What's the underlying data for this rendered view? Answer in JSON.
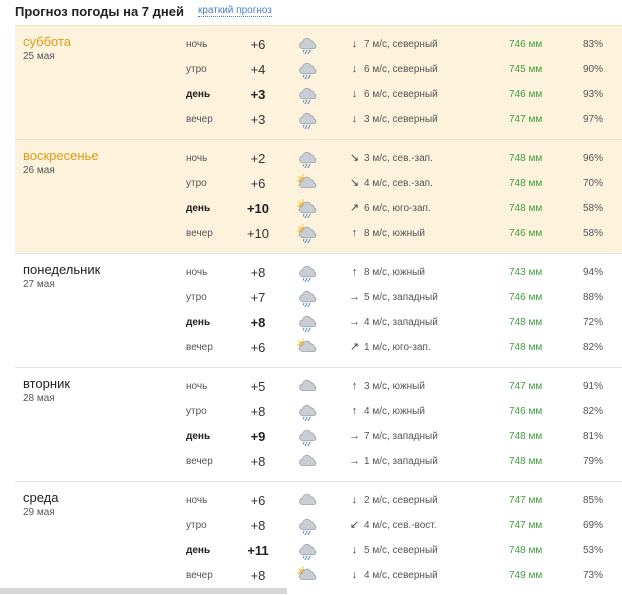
{
  "header": {
    "title": "Прогноз погоды на 7 дней",
    "brief_link": "краткий прогноз"
  },
  "days": [
    {
      "name": "суббота",
      "date": "25 мая",
      "weekend": true,
      "rows": [
        {
          "part": "ночь",
          "temp": "+6",
          "icon": "cloud-rain-icon",
          "arrow": "↓",
          "wind": "7 м/с, северный",
          "pressure": "746 мм",
          "humidity": "83%"
        },
        {
          "part": "утро",
          "temp": "+4",
          "icon": "cloud-rain-icon",
          "arrow": "↓",
          "wind": "6 м/с, северный",
          "pressure": "745 мм",
          "humidity": "90%"
        },
        {
          "part": "день",
          "temp": "+3",
          "icon": "cloud-rain-icon",
          "arrow": "↓",
          "wind": "6 м/с, северный",
          "pressure": "746 мм",
          "humidity": "93%"
        },
        {
          "part": "вечер",
          "temp": "+3",
          "icon": "cloud-rain-icon",
          "arrow": "↓",
          "wind": "3 м/с, северный",
          "pressure": "747 мм",
          "humidity": "97%"
        }
      ]
    },
    {
      "name": "воскресенье",
      "date": "26 мая",
      "weekend": true,
      "rows": [
        {
          "part": "ночь",
          "temp": "+2",
          "icon": "cloud-rain-icon",
          "arrow": "↘",
          "wind": "3 м/с, сев.-зап.",
          "pressure": "748 мм",
          "humidity": "96%"
        },
        {
          "part": "утро",
          "temp": "+6",
          "icon": "sun-cloud-icon",
          "arrow": "↘",
          "wind": "4 м/с, сев.-зап.",
          "pressure": "748 мм",
          "humidity": "70%"
        },
        {
          "part": "день",
          "temp": "+10",
          "icon": "sun-cloud-rain-icon",
          "arrow": "↗",
          "wind": "6 м/с, юго-зап.",
          "pressure": "748 мм",
          "humidity": "58%"
        },
        {
          "part": "вечер",
          "temp": "+10",
          "icon": "sun-cloud-rain-icon",
          "arrow": "↑",
          "wind": "8 м/с, южный",
          "pressure": "746 мм",
          "humidity": "58%"
        }
      ]
    },
    {
      "name": "понедельник",
      "date": "27 мая",
      "weekend": false,
      "rows": [
        {
          "part": "ночь",
          "temp": "+8",
          "icon": "cloud-rain-icon",
          "arrow": "↑",
          "wind": "8 м/с, южный",
          "pressure": "743 мм",
          "humidity": "94%"
        },
        {
          "part": "утро",
          "temp": "+7",
          "icon": "cloud-rain-icon",
          "arrow": "→",
          "wind": "5 м/с, западный",
          "pressure": "746 мм",
          "humidity": "88%"
        },
        {
          "part": "день",
          "temp": "+8",
          "icon": "cloud-rain-icon",
          "arrow": "→",
          "wind": "4 м/с, западный",
          "pressure": "748 мм",
          "humidity": "72%"
        },
        {
          "part": "вечер",
          "temp": "+6",
          "icon": "sun-cloud-icon",
          "arrow": "↗",
          "wind": "1 м/с, юго-зап.",
          "pressure": "748 мм",
          "humidity": "82%"
        }
      ]
    },
    {
      "name": "вторник",
      "date": "28 мая",
      "weekend": false,
      "rows": [
        {
          "part": "ночь",
          "temp": "+5",
          "icon": "cloud-icon",
          "arrow": "↑",
          "wind": "3 м/с, южный",
          "pressure": "747 мм",
          "humidity": "91%"
        },
        {
          "part": "утро",
          "temp": "+8",
          "icon": "cloud-rain-icon",
          "arrow": "↑",
          "wind": "4 м/с, южный",
          "pressure": "746 мм",
          "humidity": "82%"
        },
        {
          "part": "день",
          "temp": "+9",
          "icon": "cloud-rain-icon",
          "arrow": "→",
          "wind": "7 м/с, западный",
          "pressure": "748 мм",
          "humidity": "81%"
        },
        {
          "part": "вечер",
          "temp": "+8",
          "icon": "cloud-icon",
          "arrow": "→",
          "wind": "1 м/с, западный",
          "pressure": "748 мм",
          "humidity": "79%"
        }
      ]
    },
    {
      "name": "среда",
      "date": "29 мая",
      "weekend": false,
      "rows": [
        {
          "part": "ночь",
          "temp": "+6",
          "icon": "cloud-icon",
          "arrow": "↓",
          "wind": "2 м/с, северный",
          "pressure": "747 мм",
          "humidity": "85%"
        },
        {
          "part": "утро",
          "temp": "+8",
          "icon": "cloud-rain-icon",
          "arrow": "↙",
          "wind": "4 м/с, сев.-вост.",
          "pressure": "747 мм",
          "humidity": "69%"
        },
        {
          "part": "день",
          "temp": "+11",
          "icon": "cloud-rain-icon",
          "arrow": "↓",
          "wind": "5 м/с, северный",
          "pressure": "748 мм",
          "humidity": "53%"
        },
        {
          "part": "вечер",
          "temp": "+8",
          "icon": "sun-cloud-icon",
          "arrow": "↓",
          "wind": "4 м/с, северный",
          "pressure": "749 мм",
          "humidity": "73%"
        }
      ]
    }
  ],
  "colors": {
    "weekend_bg": "#fdf3dc",
    "weekend_name": "#e09a16",
    "pressure": "#3f9d3f",
    "link": "#4a7ec9"
  }
}
